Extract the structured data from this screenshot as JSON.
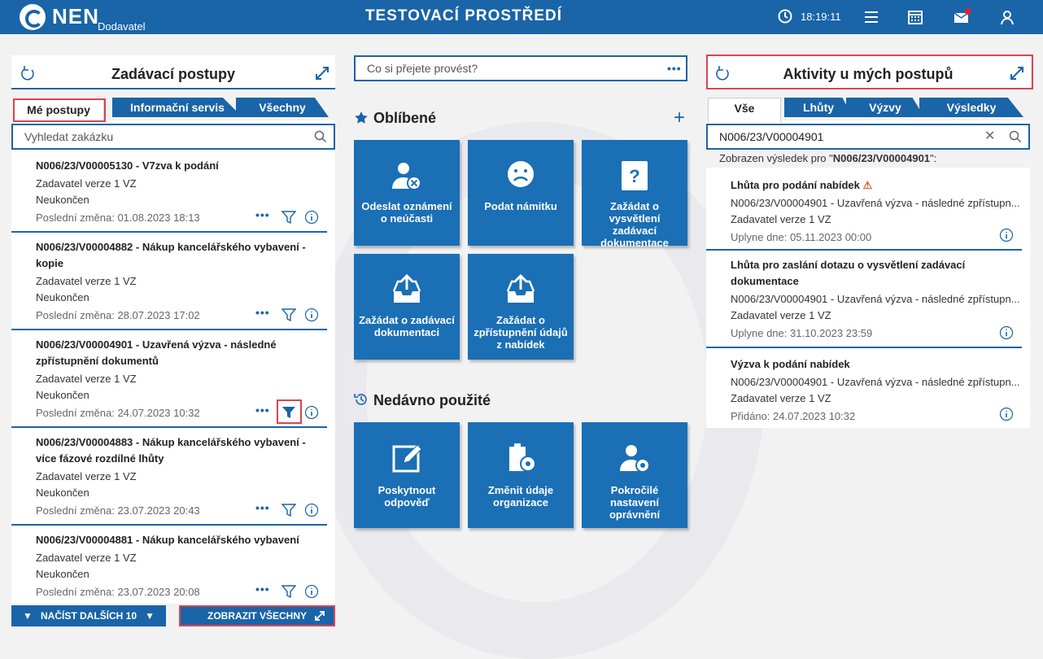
{
  "header": {
    "logo": "NEN",
    "logo_sub": "Dodavatel",
    "env_title": "TESTOVACÍ PROSTŘEDÍ",
    "time": "18:19:11"
  },
  "left": {
    "title": "Zadávací postupy",
    "tabs": [
      "Mé postupy",
      "Informační servis",
      "Všechny"
    ],
    "search_placeholder": "Vyhledat zakázku",
    "items": [
      {
        "title": "N006/23/V00005130 - V7zva k podání",
        "org": "Zadavatel verze 1 VZ",
        "status": "Neukončen",
        "changed": "Poslední změna: 01.08.2023 18:13"
      },
      {
        "title": "N006/23/V00004882 - Nákup kancelářského vybavení - kopie",
        "org": "Zadavatel verze 1 VZ",
        "status": "Neukončen",
        "changed": "Poslední změna: 28.07.2023 17:02"
      },
      {
        "title": "N006/23/V00004901 - Uzavřená výzva - následné zpřístupnění dokumentů",
        "org": "Zadavatel verze 1 VZ",
        "status": "Neukončen",
        "changed": "Poslední změna: 24.07.2023 10:32"
      },
      {
        "title": "N006/23/V00004883 - Nákup kancelářského vybavení - více fázové rozdílné lhůty",
        "org": "Zadavatel verze 1 VZ",
        "status": "Neukončen",
        "changed": "Poslední změna: 23.07.2023 20:43"
      },
      {
        "title": "N006/23/V00004881 - Nákup kancelářského vybavení",
        "org": "Zadavatel verze 1 VZ",
        "status": "Neukončen",
        "changed": "Poslední změna: 23.07.2023 20:08"
      }
    ],
    "load_more": "NAČÍST DALŠÍCH 10",
    "show_all": "ZOBRAZIT VŠECHNY"
  },
  "center": {
    "search_placeholder": "Co si přejete provést?",
    "favorites_title": "Oblíbené",
    "favorites": [
      "Odeslat oznámení o neúčasti",
      "Podat námitku",
      "Zažádat o vysvětlení zadávací dokumentace",
      "Zažádat o zadávací dokumentaci",
      "Zažádat o zpřístupnění údajů z nabídek"
    ],
    "recent_title": "Nedávno použité",
    "recent": [
      "Poskytnout odpověď",
      "Změnit údaje organizace",
      "Pokročilé nastavení oprávnění"
    ]
  },
  "right": {
    "title": "Aktivity u mých postupů",
    "tabs": [
      "Vše",
      "Lhůty",
      "Výzvy",
      "Výsledky"
    ],
    "search_value": "N006/23/V00004901",
    "result_prefix": "Zobrazen výsledek pro \"",
    "result_value": "N006/23/V00004901",
    "result_suffix": "\":",
    "items": [
      {
        "title": "Lhůta pro podání nabídek",
        "desc": "N006/23/V00004901 - Uzavřená výzva - následné zpřístupn...",
        "org": "Zadavatel verze 1 VZ",
        "date": "Uplyne dne: 05.11.2023 00:00"
      },
      {
        "title": "Lhůta pro zaslání dotazu o vysvětlení zadávací dokumentace",
        "desc": "N006/23/V00004901 - Uzavřená výzva - následné zpřístupn...",
        "org": "Zadavatel verze 1 VZ",
        "date": "Uplyne dne: 31.10.2023 23:59"
      },
      {
        "title": "Výzva k podání nabídek",
        "desc": "N006/23/V00004901 - Uzavřená výzva - následné zpřístupn...",
        "org": "Zadavatel verze 1 VZ",
        "date": "Přidáno: 24.07.2023 10:32"
      }
    ]
  },
  "colors": {
    "primary": "#1a64a8",
    "tile": "#1a6fb5",
    "highlight": "#d9454f",
    "warning": "#e05a2a"
  }
}
